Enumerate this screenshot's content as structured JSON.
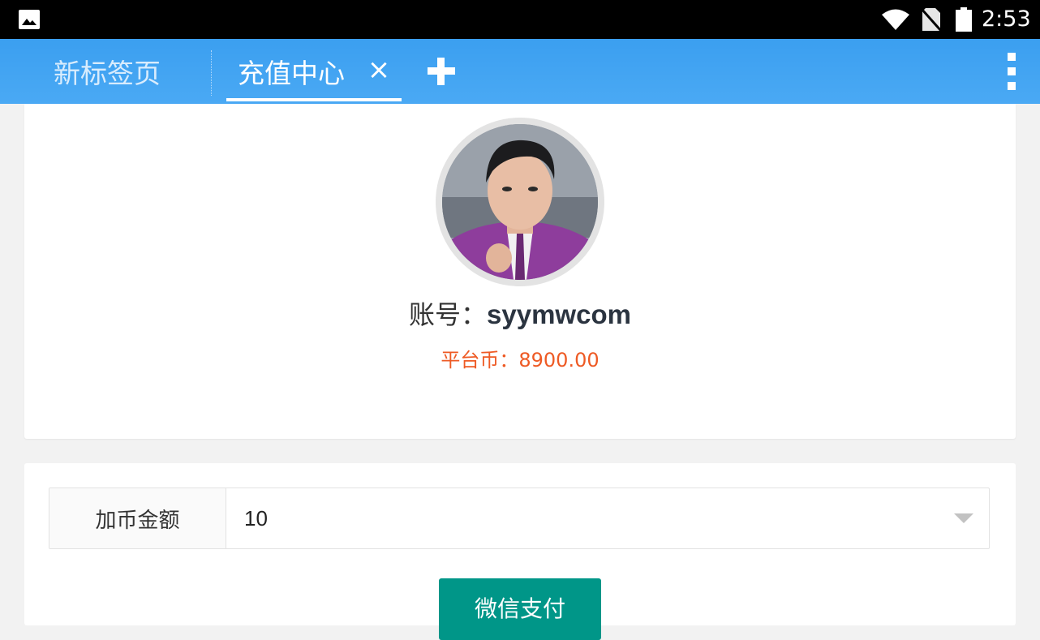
{
  "status_bar": {
    "time": "2:53",
    "icons": [
      "gallery-icon",
      "wifi-icon",
      "no-sim-icon",
      "battery-icon"
    ]
  },
  "tabs": [
    {
      "label": "新标签页",
      "active": false
    },
    {
      "label": "充值中心",
      "active": true
    }
  ],
  "tab_bar": {
    "close_symbol": "×",
    "accent_color": "#3b9ff0"
  },
  "profile": {
    "account_label": "账号：",
    "account_value": "syymwcom",
    "coins_label": "平台币：",
    "coins_value": "8900.00"
  },
  "recharge": {
    "amount_label": "加币金额",
    "amount_value": "10",
    "pay_button_label": "微信支付",
    "pay_button_color": "#009688"
  }
}
